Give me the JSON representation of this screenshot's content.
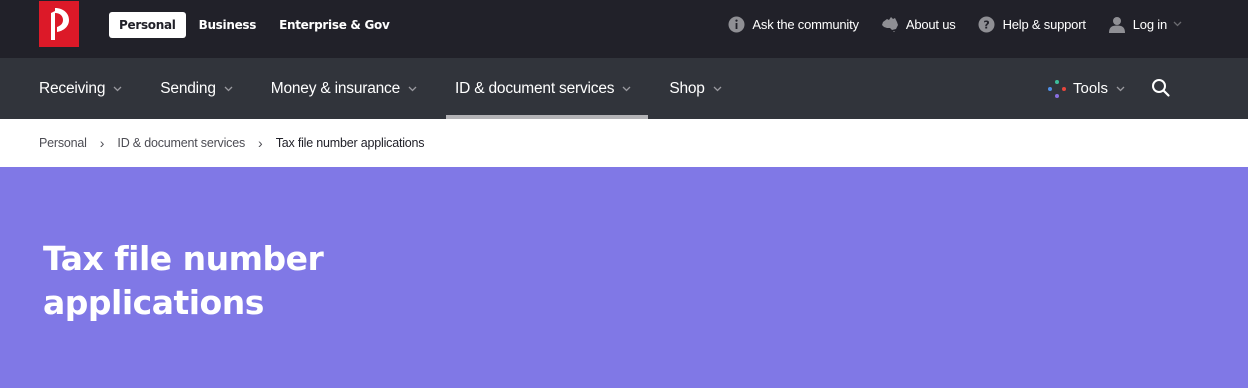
{
  "top_bar": {
    "logo_icon": "auspost-logo-icon",
    "segments": [
      {
        "label": "Personal",
        "active": true
      },
      {
        "label": "Business",
        "active": false
      },
      {
        "label": "Enterprise & Gov",
        "active": false
      }
    ],
    "utilities": [
      {
        "label": "Ask the community",
        "icon": "info-icon"
      },
      {
        "label": "About us",
        "icon": "australia-map-icon"
      },
      {
        "label": "Help & support",
        "icon": "help-icon"
      },
      {
        "label": "Log in",
        "icon": "user-icon",
        "has_dropdown": true
      }
    ]
  },
  "main_nav": {
    "items": [
      {
        "label": "Receiving",
        "has_dropdown": true
      },
      {
        "label": "Sending",
        "has_dropdown": true
      },
      {
        "label": "Money & insurance",
        "has_dropdown": true
      },
      {
        "label": "ID & document services",
        "has_dropdown": true,
        "active": true
      },
      {
        "label": "Shop",
        "has_dropdown": true
      }
    ],
    "tools_label": "Tools",
    "tools_icon": "tools-dots-icon",
    "search_icon": "search-icon"
  },
  "breadcrumb": {
    "items": [
      "Personal",
      "ID & document services",
      "Tax file number applications"
    ]
  },
  "hero": {
    "title_line1": "Tax file number",
    "title_line2": "applications"
  },
  "colors": {
    "top_bar_bg": "#212129",
    "nav_bg": "#31343b",
    "brand_red": "#dc1928",
    "hero_bg": "#8078e6"
  }
}
